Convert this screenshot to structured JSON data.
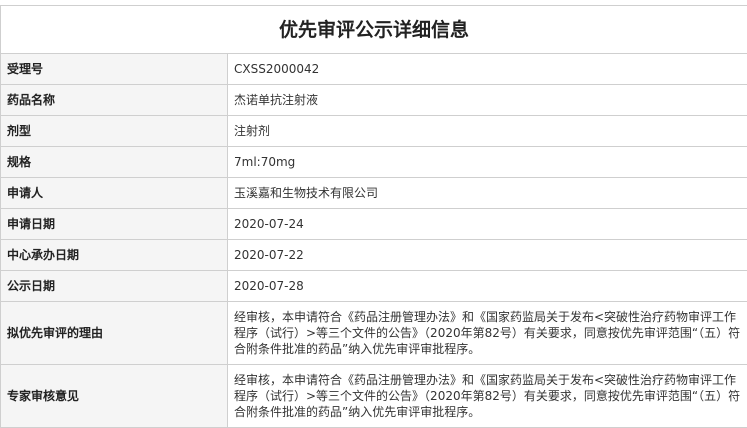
{
  "page": {
    "title": "优先审评公示详细信息"
  },
  "rows": [
    {
      "label": "受理号",
      "value": "CXSS2000042"
    },
    {
      "label": "药品名称",
      "value": "杰诺单抗注射液"
    },
    {
      "label": "剂型",
      "value": "注射剂"
    },
    {
      "label": "规格",
      "value": "7ml:70mg"
    },
    {
      "label": "申请人",
      "value": "玉溪嘉和生物技术有限公司"
    },
    {
      "label": "申请日期",
      "value": "2020-07-24"
    },
    {
      "label": "中心承办日期",
      "value": "2020-07-22"
    },
    {
      "label": "公示日期",
      "value": "2020-07-28"
    },
    {
      "label": "拟优先审评的理由",
      "value": "经审核，本申请符合《药品注册管理办法》和《国家药监局关于发布<突破性治疗药物审评工作程序（试行）>等三个文件的公告》（2020年第82号）有关要求，同意按优先审评范围“（五）符合附条件批准的药品”纳入优先审评审批程序。"
    },
    {
      "label": "专家审核意见",
      "value": "经审核，本申请符合《药品注册管理办法》和《国家药监局关于发布<突破性治疗药物审评工作程序（试行）>等三个文件的公告》（2020年第82号）有关要求，同意按优先审评范围“（五）符合附条件批准的药品”纳入优先审评审批程序。"
    }
  ]
}
